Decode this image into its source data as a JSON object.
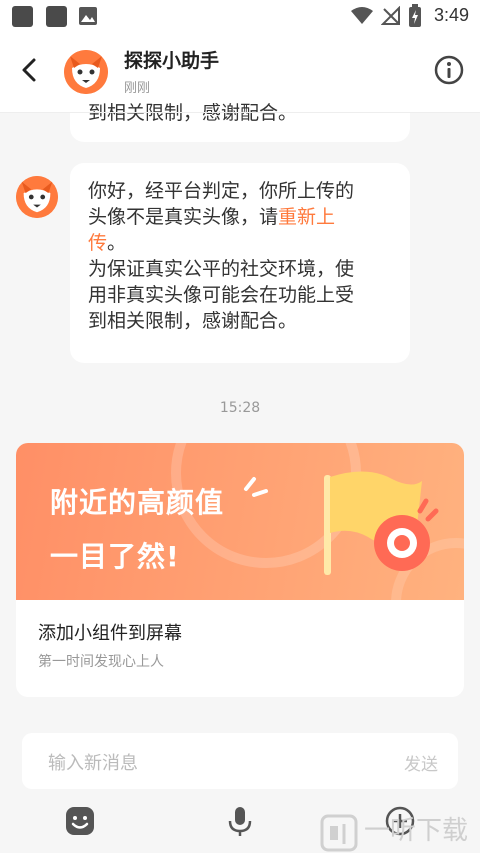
{
  "status_bar": {
    "time": "3:49"
  },
  "header": {
    "title": "探探小助手",
    "subtitle": "刚刚"
  },
  "top_message": {
    "partial_text": "到相关限制，感谢配合。"
  },
  "message": {
    "line1": "你好，经平台判定，你所上传的",
    "line2_pre": "头像不是真实头像，请",
    "link_part1": "重新上",
    "link_part2": "传",
    "line3_post": "。",
    "line4": "为保证真实公平的社交环境，使",
    "line5": "用非真实头像可能会在功能上受",
    "line6": "到相关限制，感谢配合。"
  },
  "timestamp": "15:28",
  "card": {
    "banner_line1": "附近的高颜值",
    "banner_line2": "一目了然!",
    "title": "添加小组件到屏幕",
    "subtitle": "第一时间发现心上人"
  },
  "input": {
    "placeholder": "输入新消息",
    "send_label": "发送"
  },
  "watermark": {
    "text": "一听下载"
  },
  "colors": {
    "accent": "#ff7a3d",
    "banner_start": "#ff8f66",
    "banner_end": "#ffb27f"
  }
}
